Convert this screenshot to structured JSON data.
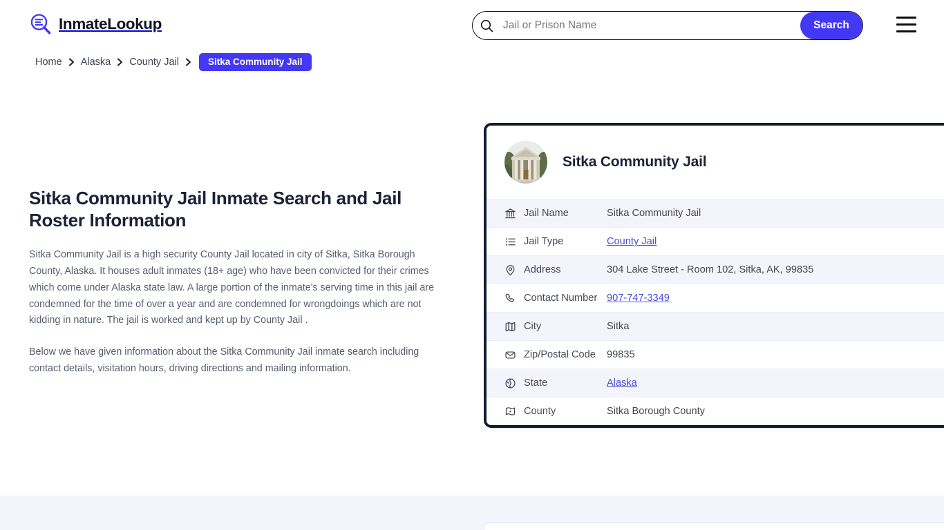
{
  "brand": {
    "name": "InmateLookup",
    "logo_icon": "magnifier-list-icon",
    "accent_color": "#4338f5",
    "dark_color": "#131b33"
  },
  "search": {
    "placeholder": "Jail or Prison Name",
    "value": "",
    "button_label": "Search",
    "icon": "search-icon"
  },
  "menu": {
    "icon": "hamburger-menu-icon"
  },
  "breadcrumb": {
    "items": [
      {
        "label": "Home",
        "active": false
      },
      {
        "label": "Alaska",
        "active": false
      },
      {
        "label": "County Jail",
        "active": false
      },
      {
        "label": "Sitka Community Jail",
        "active": true
      }
    ],
    "separator_icon": "chevron-right-icon"
  },
  "main": {
    "title": "Sitka Community Jail Inmate Search and Jail Roster Information",
    "paragraph_1": "Sitka Community Jail is a high security County Jail located in city of Sitka, Sitka Borough County, Alaska. It houses adult inmates (18+ age) who have been convicted for their crimes which come under Alaska state law. A large portion of the inmate's serving time in this jail are condemned for the time of over a year and are condemned for wrongdoings which are not kidding in nature. The jail is worked and kept up by County Jail .",
    "paragraph_2": "Below we have given information about the Sitka Community Jail inmate search including contact details, visitation hours, driving directions and mailing information."
  },
  "info_card": {
    "avatar_icon": "jail-building-photo",
    "title": "Sitka Community Jail",
    "rows": [
      {
        "icon": "bank-building-icon",
        "label": "Jail Name",
        "value": "Sitka Community Jail",
        "link": false
      },
      {
        "icon": "list-icon",
        "label": "Jail Type",
        "value": "County Jail",
        "link": true
      },
      {
        "icon": "map-pin-icon",
        "label": "Address",
        "value": "304 Lake Street - Room 102, Sitka, AK, 99835",
        "link": false
      },
      {
        "icon": "phone-icon",
        "label": "Contact Number",
        "value": "907-747-3349",
        "link": true
      },
      {
        "icon": "map-folded-icon",
        "label": "City",
        "value": "Sitka",
        "link": false
      },
      {
        "icon": "envelope-icon",
        "label": "Zip/Postal Code",
        "value": "99835",
        "link": false
      },
      {
        "icon": "globe-icon",
        "label": "State",
        "value": "Alaska",
        "link": true
      },
      {
        "icon": "region-map-icon",
        "label": "County",
        "value": "Sitka Borough County",
        "link": false
      }
    ]
  }
}
